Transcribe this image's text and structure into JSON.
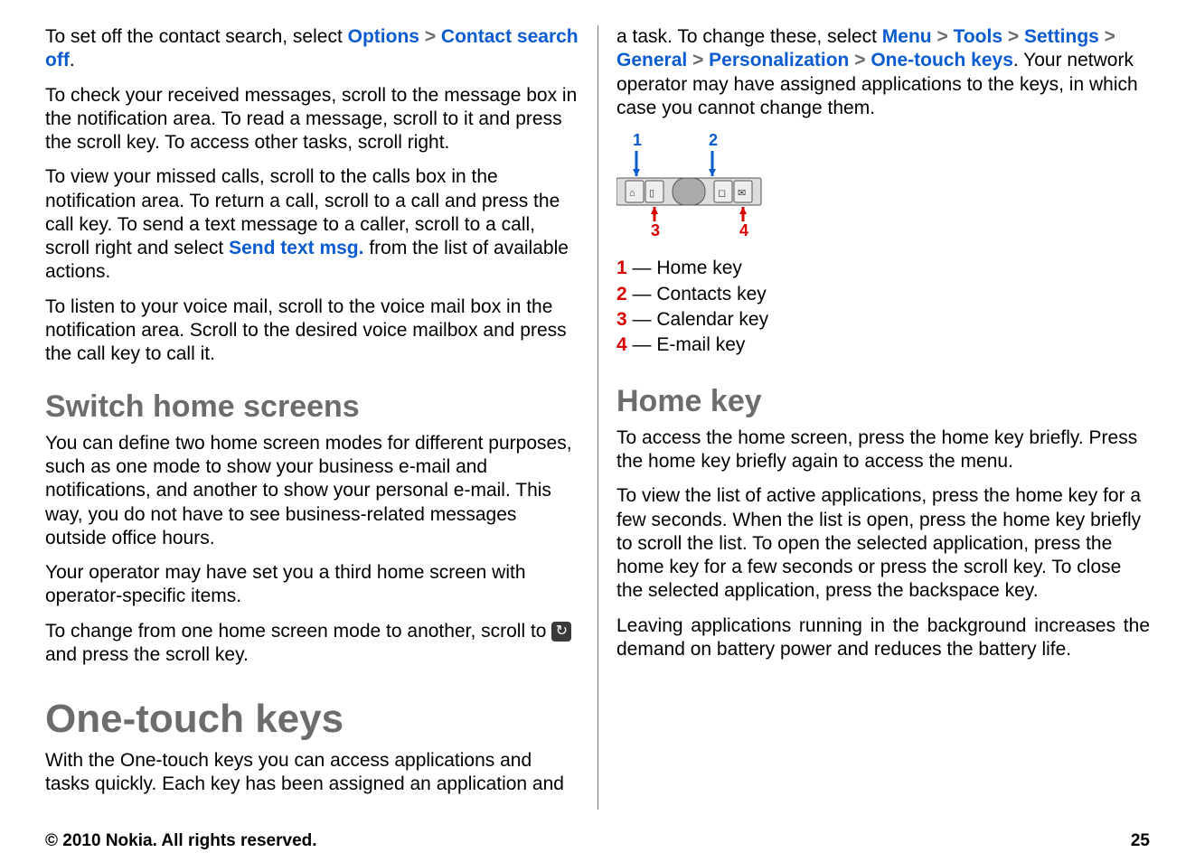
{
  "left": {
    "p1_a": "To set off the contact search, select ",
    "p1_link1": "Options",
    "p1_b": "Contact search off",
    "p1_c": ".",
    "p2": "To check your received messages, scroll to the message box in the notification area. To read a message, scroll to it and press the scroll key. To access other tasks, scroll right.",
    "p3_a": "To view your missed calls, scroll to the calls box in the notification area. To return a call, scroll to a call and press the call key. To send a text message to a caller, scroll to a call, scroll right and select ",
    "p3_link": "Send text msg.",
    "p3_b": " from the list of available actions.",
    "p4": "To listen to your voice mail, scroll to the voice mail box in the notification area. Scroll to the desired voice mailbox and press the call key to call it.",
    "h_switch": "Switch home screens",
    "p5": "You can define two home screen modes for different purposes, such as one mode to show your business e-mail and notifications, and another to show your personal e-mail. This way, you do not have to see business-related messages outside office hours.",
    "p6": "Your operator may have set you a third home screen with operator-specific items.",
    "p7_a": "To change from one home screen mode to another, scroll to ",
    "p7_b": " and press the scroll key.",
    "h_one": "One-touch keys",
    "p8": "With the One-touch keys you can access applications and tasks quickly. Each key has been assigned an application and"
  },
  "right": {
    "p1_a": "a task. To change these, select ",
    "p1_links": [
      "Menu",
      "Tools",
      "Settings",
      "General",
      "Personalization",
      "One-touch keys"
    ],
    "p1_b": ". Your network operator may have assigned applications to the keys, in which case you cannot change them.",
    "keys": [
      {
        "n": "1",
        "label": " — Home key"
      },
      {
        "n": "2",
        "label": " — Contacts key"
      },
      {
        "n": "3",
        "label": " — Calendar key"
      },
      {
        "n": "4",
        "label": " — E-mail key"
      }
    ],
    "h_home": "Home key",
    "p2": "To access the home screen, press the home key briefly. Press the home key briefly again to access the menu.",
    "p3": "To view the list of active applications, press the home key for a few seconds. When the list is open, press the home key briefly to scroll the list. To open the selected application, press the home key for a few seconds or press the scroll key. To close the selected application, press the backspace key.",
    "p4": "Leaving applications running in the background increases the demand on battery power and reduces the battery life."
  },
  "footer": {
    "copyright": "© 2010 Nokia. All rights reserved.",
    "page": "25"
  },
  "misc": {
    "chev": ">"
  }
}
